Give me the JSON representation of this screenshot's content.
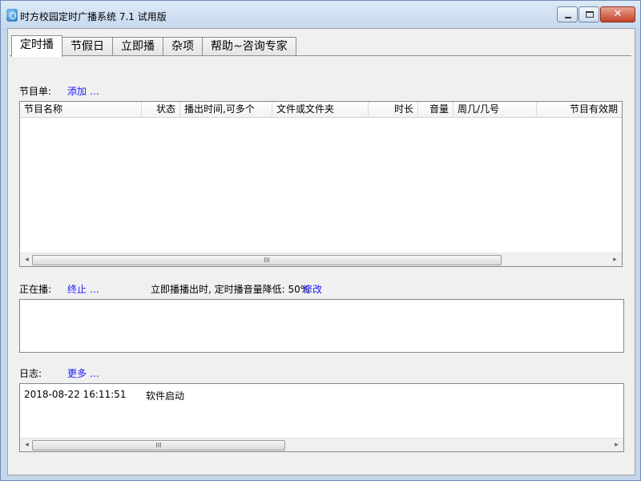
{
  "window": {
    "title": "时方校园定时广播系统 7.1 试用版",
    "close_glyph": "✕"
  },
  "tabs": [
    {
      "label": "定时播",
      "active": true
    },
    {
      "label": "节假日"
    },
    {
      "label": "立即播"
    },
    {
      "label": "杂项"
    },
    {
      "label": "帮助~咨询专家"
    }
  ],
  "programs": {
    "label": "节目单:",
    "add_link": "添加 …",
    "columns": [
      "节目名称",
      "状态",
      "播出时间,可多个",
      "文件或文件夹",
      "时长",
      "音量",
      "周几/几号",
      "节目有效期"
    ],
    "rows": []
  },
  "now_playing": {
    "label": "正在播:",
    "stop_link": "终止 …",
    "info": "立即播播出时, 定时播音量降低: 50%",
    "modify_link": "修改"
  },
  "log": {
    "label": "日志:",
    "more_link": "更多 …",
    "entries": [
      {
        "time": "2018-08-22 16:11:51",
        "message": "软件启动"
      }
    ]
  },
  "scroll": {
    "left_arrow": "◂",
    "right_arrow": "▸",
    "grip": "III"
  }
}
